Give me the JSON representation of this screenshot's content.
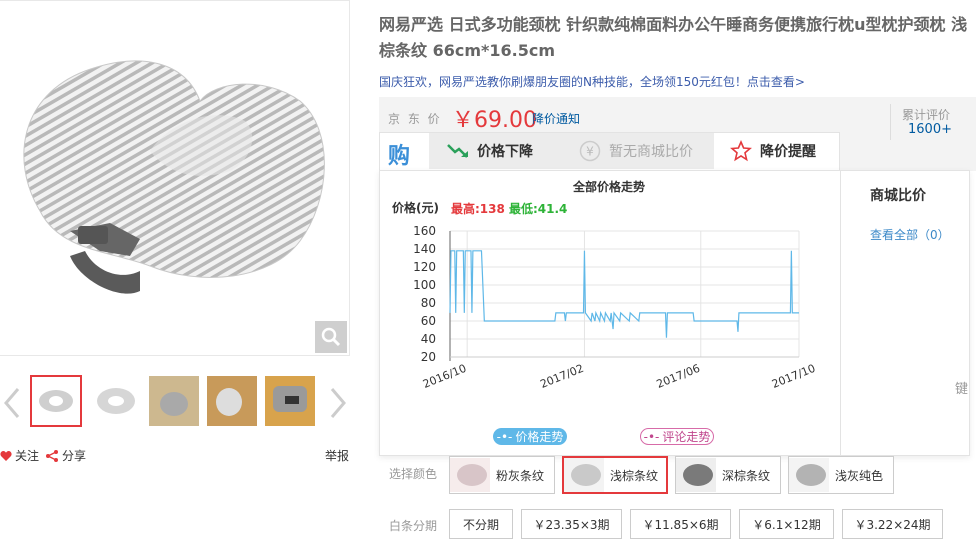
{
  "product": {
    "title": "网易严选 日式多功能颈枕 针织款纯棉面料办公午睡商务便携旅行枕u型枕护颈枕 浅棕条纹 66cm*16.5cm",
    "promo": "国庆狂欢，网易严选教你刷爆朋友圈的N种技能，全场领150元红包！点击查看>"
  },
  "gallery": {
    "thumbnail_count": 5,
    "active_index": 0,
    "follow_label": "关注",
    "share_label": "分享",
    "report_label": "举报"
  },
  "price": {
    "label": "京 东 价",
    "value": "￥69.00",
    "notify_label": "降价通知",
    "review_label": "累计评价",
    "review_count": "1600+"
  },
  "tabs": {
    "buy_icon_text": "购",
    "price_down": "价格下降",
    "no_compare": "暂无商城比价",
    "price_alert": "降价提醒"
  },
  "chart_panel": {
    "title": "全部价格走势",
    "y_unit": "价格(元)",
    "max_text": "最高:138",
    "min_text": "最低:41.4",
    "legend_price": "价格走势",
    "legend_review": "评论走势",
    "compare_title": "商城比价",
    "compare_link": "查看全部（0）"
  },
  "chart_data": {
    "type": "line",
    "yticks": [
      160,
      140,
      120,
      100,
      80,
      60,
      40,
      20
    ],
    "ylim": [
      20,
      160
    ],
    "xticks": [
      "2016/10",
      "2017/02",
      "2017/06",
      "2017/10"
    ],
    "xlim_days": [
      0,
      366
    ],
    "xtick_days": [
      18,
      141,
      263,
      384
    ],
    "series": [
      {
        "name": "价格走势",
        "color": "#5fb8e8",
        "points": [
          [
            0,
            69
          ],
          [
            1,
            138
          ],
          [
            5,
            138
          ],
          [
            6,
            69
          ],
          [
            7,
            138
          ],
          [
            14,
            138
          ],
          [
            15,
            69
          ],
          [
            16,
            138
          ],
          [
            22,
            138
          ],
          [
            23,
            69
          ],
          [
            24,
            138
          ],
          [
            33,
            138
          ],
          [
            36,
            60
          ],
          [
            37,
            60
          ],
          [
            110,
            60
          ],
          [
            111,
            69
          ],
          [
            120,
            69
          ],
          [
            121,
            60
          ],
          [
            122,
            69
          ],
          [
            140,
            69
          ],
          [
            141,
            138
          ],
          [
            142,
            69
          ],
          [
            148,
            60
          ],
          [
            149,
            69
          ],
          [
            152,
            60
          ],
          [
            153,
            69
          ],
          [
            157,
            60
          ],
          [
            158,
            69
          ],
          [
            162,
            60
          ],
          [
            163,
            69
          ],
          [
            168,
            60
          ],
          [
            169,
            69
          ],
          [
            171,
            51
          ],
          [
            172,
            69
          ],
          [
            178,
            60
          ],
          [
            179,
            69
          ],
          [
            188,
            60
          ],
          [
            189,
            69
          ],
          [
            198,
            60
          ],
          [
            199,
            69
          ],
          [
            220,
            69
          ],
          [
            226,
            69
          ],
          [
            227,
            41.4
          ],
          [
            228,
            69
          ],
          [
            255,
            69
          ],
          [
            256,
            60
          ],
          [
            295,
            60
          ],
          [
            301,
            60
          ],
          [
            302,
            48
          ],
          [
            303,
            69
          ],
          [
            357,
            69
          ],
          [
            358,
            138
          ],
          [
            359,
            69
          ],
          [
            366,
            69
          ]
        ]
      }
    ]
  },
  "colors": {
    "label": "选择颜色",
    "options": [
      "粉灰条纹",
      "浅棕条纹",
      "深棕条纹",
      "浅灰纯色"
    ],
    "selected_index": 1
  },
  "installment": {
    "label": "白条分期",
    "options": [
      "不分期",
      "￥23.35×3期",
      "￥11.85×6期",
      "￥6.1×12期",
      "￥3.22×24期"
    ]
  },
  "side_stub": "键",
  "accent": {
    "red": "#e4393c",
    "blue": "#005aa0",
    "chart": "#5fb8e8"
  }
}
